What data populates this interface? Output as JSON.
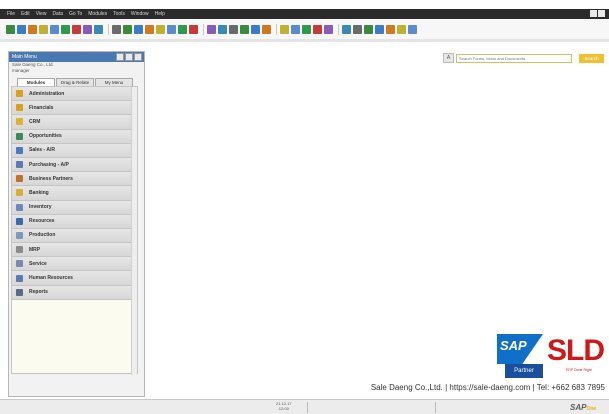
{
  "menubar": {
    "items": [
      "File",
      "Edit",
      "View",
      "Data",
      "Go To",
      "Modules",
      "Tools",
      "Window",
      "Help"
    ]
  },
  "toolbar": {
    "icons": [
      "print-icon",
      "print-preview-icon",
      "email-icon",
      "export-icon",
      "word-icon",
      "excel-icon",
      "pdf-icon",
      "launch-icon",
      "filter-icon",
      "sep",
      "find-icon",
      "add-icon",
      "first-record-icon",
      "previous-record-icon",
      "next-record-icon",
      "last-record-icon",
      "refresh-icon",
      "sort-icon",
      "sep",
      "base-document-icon",
      "target-document-icon",
      "gross-profit-icon",
      "journal-icon",
      "payment-icon",
      "settings-icon",
      "sep",
      "form-settings-icon",
      "lock-icon",
      "user-icon",
      "messages-icon",
      "calendar-icon",
      "sep",
      "layout-designer-icon",
      "query-manager-icon",
      "calculator-icon",
      "help-icon",
      "globe-icon",
      "alert-icon",
      "more-icon"
    ],
    "icon_colors": [
      "#3c8a3c",
      "#3a7cc8",
      "#d07a20",
      "#c0b030",
      "#5a8ad0",
      "#2e9a4a",
      "#c83a3a",
      "#8a5ab8",
      "#3a8ab8",
      "#6a6a6a"
    ]
  },
  "search": {
    "icon": "search-icon",
    "icon_glyph": "A",
    "placeholder": "Search Forms, Items and Documents",
    "button_label": "Search"
  },
  "main_menu": {
    "title": "Main Menu",
    "company": "Sale Daeng Co., Ltd.",
    "user": "manager",
    "tabs": [
      "Modules",
      "Drag & Relate",
      "My Menu"
    ],
    "active_tab": 0,
    "items": [
      {
        "label": "Administration",
        "icon": "administration-icon",
        "color": "#d8a020"
      },
      {
        "label": "Financials",
        "icon": "financials-icon",
        "color": "#d8a020"
      },
      {
        "label": "CRM",
        "icon": "crm-icon",
        "color": "#e0b030"
      },
      {
        "label": "Opportunities",
        "icon": "opportunities-icon",
        "color": "#3a8a5a"
      },
      {
        "label": "Sales - A/R",
        "icon": "sales-icon",
        "color": "#4a7ac0"
      },
      {
        "label": "Purchasing - A/P",
        "icon": "purchasing-icon",
        "color": "#5a7ab8"
      },
      {
        "label": "Business Partners",
        "icon": "business-partners-icon",
        "color": "#c07030"
      },
      {
        "label": "Banking",
        "icon": "banking-icon",
        "color": "#d8b030"
      },
      {
        "label": "Inventory",
        "icon": "inventory-icon",
        "color": "#6a8ab8"
      },
      {
        "label": "Resources",
        "icon": "resources-icon",
        "color": "#3a6ab0"
      },
      {
        "label": "Production",
        "icon": "production-icon",
        "color": "#7a9ac0"
      },
      {
        "label": "MRP",
        "icon": "mrp-icon",
        "color": "#8a8a8a"
      },
      {
        "label": "Service",
        "icon": "service-icon",
        "color": "#7a8ab0"
      },
      {
        "label": "Human Resources",
        "icon": "human-resources-icon",
        "color": "#5a7ab0"
      },
      {
        "label": "Reports",
        "icon": "reports-icon",
        "color": "#5a6a8a"
      }
    ]
  },
  "branding": {
    "sap_text": "SAP",
    "partner_text": "Partner",
    "sld_text": "SLD",
    "sld_tagline": "ERP Done Right",
    "footer": "Sale Daeng Co.,Ltd. | https://sale-daeng.com  | Tel: +662 683 7895",
    "sap_blue": "#1070c8",
    "sld_red": "#d01818"
  },
  "statusbar": {
    "date": "21.12.17",
    "time": "12:00",
    "logo": "SAP",
    "logo_suffix": "One"
  }
}
